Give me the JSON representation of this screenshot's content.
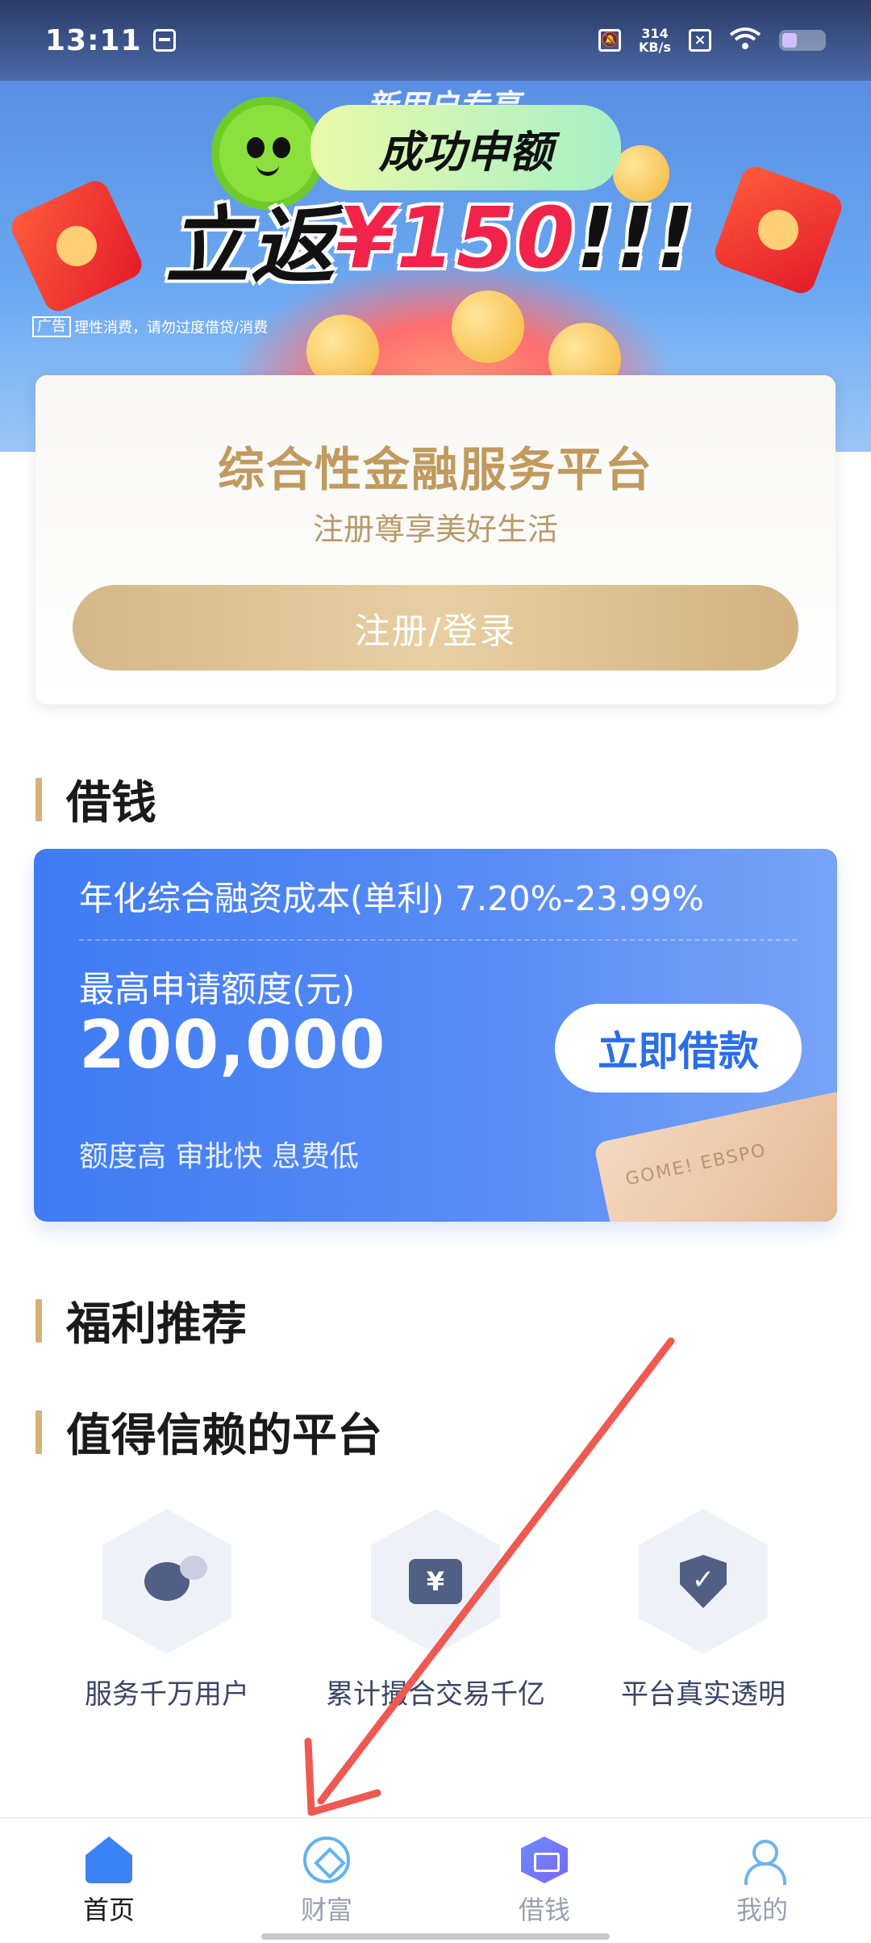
{
  "status_bar": {
    "time": "13:11",
    "network_speed_value": "314",
    "network_speed_unit": "KB/s"
  },
  "banner": {
    "subtitle": "新用户专享",
    "pill_title": "成功申额",
    "big_title_prefix": "立返",
    "big_title_amount": "¥150",
    "big_title_suffix": "!!!",
    "ad_tag": "广告",
    "ad_note": "理性消费，请勿过度借贷/消费"
  },
  "register_card": {
    "title": "综合性金融服务平台",
    "subtitle": "注册尊享美好生活",
    "button_label": "注册/登录"
  },
  "sections": {
    "loan_title": "借钱",
    "welfare_title": "福利推荐",
    "trust_title": "值得信赖的平台"
  },
  "loan_card": {
    "rate_text": "年化综合融资成本(单利) 7.20%-23.99%",
    "limit_label": "最高申请额度(元)",
    "limit_amount": "200,000",
    "button_label": "立即借款",
    "tags": "额度高 审批快 息费低",
    "deco_text": "GOME! EBSPO"
  },
  "features": [
    {
      "label": "服务千万用户",
      "icon": "chat-icon"
    },
    {
      "label": "累计撮合交易千亿",
      "icon": "wallet-icon",
      "glyph": "¥"
    },
    {
      "label": "平台真实透明",
      "icon": "shield-check-icon",
      "glyph": "✓"
    }
  ],
  "bottom_nav": [
    {
      "label": "首页",
      "icon": "home-icon",
      "active": true
    },
    {
      "label": "财富",
      "icon": "wealth-icon",
      "active": false
    },
    {
      "label": "借钱",
      "icon": "loan-icon",
      "active": false
    },
    {
      "label": "我的",
      "icon": "profile-icon",
      "active": false
    }
  ],
  "colors": {
    "accent_gold": "#d5b27a",
    "primary_blue": "#3f7bf3",
    "highlight_red": "#f2234b",
    "annotation_arrow": "#ee5a52"
  }
}
